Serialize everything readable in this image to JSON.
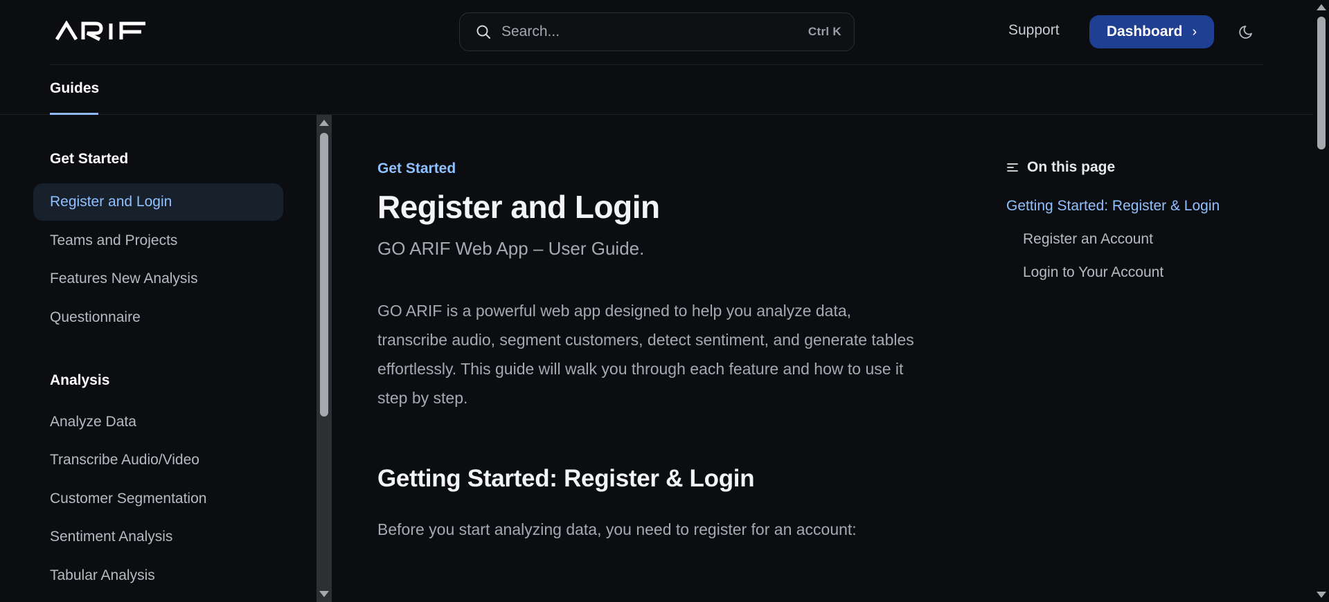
{
  "brand": {
    "logo_text": "ARIF"
  },
  "search": {
    "placeholder": "Search...",
    "shortcut": "Ctrl K"
  },
  "header": {
    "support_label": "Support",
    "dashboard_label": "Dashboard",
    "dashboard_chevron": "›",
    "tabs": [
      {
        "label": "Guides",
        "active": true
      }
    ]
  },
  "sidebar": {
    "sections": [
      {
        "heading": "Get Started",
        "items": [
          {
            "label": "Register and Login",
            "active": true
          },
          {
            "label": "Teams and Projects"
          },
          {
            "label": "Features New Analysis"
          },
          {
            "label": "Questionnaire"
          }
        ]
      },
      {
        "heading": "Analysis",
        "items": [
          {
            "label": "Analyze Data"
          },
          {
            "label": "Transcribe Audio/Video"
          },
          {
            "label": "Customer Segmentation"
          },
          {
            "label": "Sentiment Analysis"
          },
          {
            "label": "Tabular Analysis"
          }
        ]
      }
    ]
  },
  "main": {
    "eyebrow": "Get Started",
    "title": "Register and Login",
    "subtitle": "GO ARIF Web App – User Guide.",
    "intro": "GO ARIF is a powerful web app designed to help you analyze data, transcribe audio, segment customers, detect sentiment, and generate tables effortlessly. This guide will walk you through each feature and how to use it step by step.",
    "section_heading": "Getting Started: Register & Login",
    "section_text": "Before you start analyzing data, you need to register for an account:"
  },
  "toc": {
    "heading": "On this page",
    "links": [
      {
        "label": "Getting Started: Register & Login",
        "active": true,
        "level": 1
      },
      {
        "label": "Register an Account",
        "level": 2
      },
      {
        "label": "Login to Your Account",
        "level": 2
      }
    ]
  },
  "colors": {
    "background": "#0c0d11",
    "accent": "#8fc0ff",
    "primary_button": "#1f3f92",
    "active_item_bg": "#18202c"
  },
  "icons": {
    "search": "search-icon",
    "theme": "moon-icon",
    "toc": "list-icon",
    "chevron": "chevron-right-icon"
  }
}
